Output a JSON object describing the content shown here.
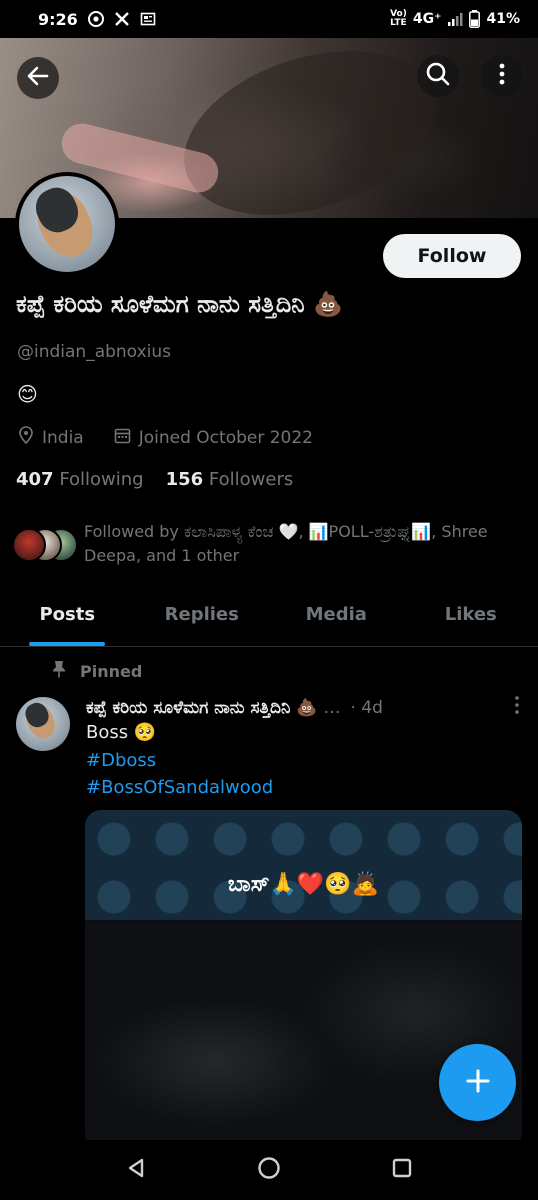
{
  "status_bar": {
    "time": "9:26",
    "left_icons": [
      "chrome-icon",
      "x-icon",
      "news-icon"
    ],
    "network_top": "Vo)",
    "network_bottom": "LTE",
    "network_type": "4G⁺",
    "battery": "41%"
  },
  "header": {
    "back_icon": "arrow-left-icon",
    "search_icon": "search-icon",
    "more_icon": "more-vertical-icon"
  },
  "profile": {
    "follow_label": "Follow",
    "display_name": "ಕಪ್ಪೆ ಕರಿಯ ಸೂಳೆಮಗ ನಾನು ಸತ್ತಿದಿನಿ 💩",
    "handle": "@indian_abnoxius",
    "bio": "😊",
    "location": "India",
    "joined": "Joined October 2022",
    "following_count": "407",
    "following_label": "Following",
    "followers_count": "156",
    "followers_label": "Followers",
    "followed_by": "Followed by ಕಲಾಸಿಪಾಳ್ಯ ಕೆಂಚ 🤍, 📊POLL-ಶತ್ರುಘ್ನ📊, Shree Deepa, and 1 other"
  },
  "tabs": [
    {
      "label": "Posts",
      "active": true
    },
    {
      "label": "Replies",
      "active": false
    },
    {
      "label": "Media",
      "active": false
    },
    {
      "label": "Likes",
      "active": false
    }
  ],
  "post": {
    "pinned_label": "Pinned",
    "author": "ಕಪ್ಪೆ ಕರಿಯ ಸೂಳೆಮಗ ನಾನು ಸತ್ತಿದಿನಿ 💩",
    "ellipsis": "…",
    "time": "· 4d",
    "text": "Boss 🥺",
    "hashtags": [
      "#Dboss",
      "#BossOfSandalwood"
    ],
    "media_caption": "ಬಾಸ್🙏❤️🥺🙇"
  },
  "fab_icon": "plus-icon",
  "nav": [
    "back-triangle-icon",
    "home-circle-icon",
    "recents-square-icon"
  ],
  "colors": {
    "accent": "#1d9bf0",
    "text_primary": "#e7e9ea",
    "text_secondary": "#71767b",
    "background": "#000000"
  }
}
